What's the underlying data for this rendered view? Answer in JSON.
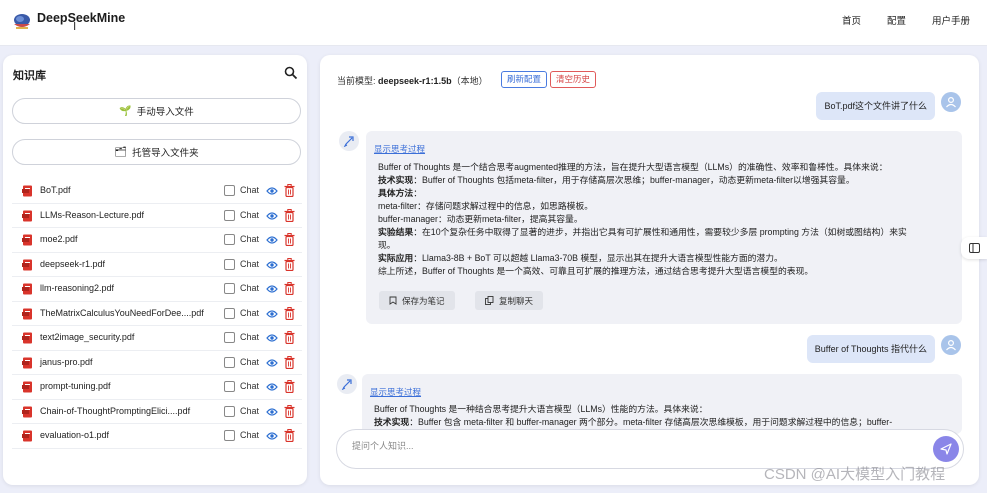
{
  "header": {
    "brand": "DeepSeekMine",
    "nav": [
      "首页",
      "配置",
      "用户手册"
    ]
  },
  "knowledge_base": {
    "title": "知识库",
    "manual_import_label": "手动导入文件",
    "managed_import_label": "托管导入文件夹",
    "chat_label": "Chat",
    "files": [
      "BoT.pdf",
      "LLMs-Reason-Lecture.pdf",
      "moe2.pdf",
      "deepseek-r1.pdf",
      "llm-reasoning2.pdf",
      "TheMatrixCalculusYouNeedForDee....pdf",
      "text2image_security.pdf",
      "janus-pro.pdf",
      "prompt-tuning.pdf",
      "Chain-of-ThoughtPromptingElici....pdf",
      "evaluation-o1.pdf"
    ]
  },
  "chat": {
    "model_prefix": "当前模型:",
    "model_name": "deepseek-r1:1.5b",
    "model_suffix": "（本地）",
    "refresh_label": "刷新配置",
    "clear_label": "清空历史",
    "messages": [
      {
        "user": "BoT.pdf这个文件讲了什么",
        "think_link": "显示思考过程",
        "answer_lines": [
          {
            "bold": "",
            "text": "Buffer of Thoughts 是一个结合思考augmented推理的方法，旨在提升大型语言模型（LLMs）的准确性、效率和鲁棒性。具体来说："
          },
          {
            "bold": "技术实现",
            "text": "：Buffer of Thoughts 包括meta-filter，用于存储高层次思维；buffer-manager，动态更新meta-filter以增强其容量。"
          },
          {
            "bold": "具体方法",
            "text": "："
          },
          {
            "bold": "",
            "text": "meta-filter：存储问题求解过程中的信息，如思路模板。"
          },
          {
            "bold": "",
            "text": "buffer-manager：动态更新meta-filter，提高其容量。"
          },
          {
            "bold": "实验结果",
            "text": "：在10个复杂任务中取得了显著的进步，并指出它具有可扩展性和通用性，需要较少多层 prompting 方法（如树或图结构）来实"
          },
          {
            "bold": "",
            "text": "现。"
          },
          {
            "bold": "实际应用",
            "text": "：Llama3-8B + BoT 可以超越 Llama3-70B 模型，显示出其在提升大语言模型性能方面的潜力。"
          },
          {
            "bold": "",
            "text": "综上所述，Buffer of Thoughts 是一个高效、可靠且可扩展的推理方法，通过结合思考提升大型语言模型的表现。"
          }
        ],
        "save_note_label": "保存为笔记",
        "copy_chat_label": "复制聊天"
      },
      {
        "user": "Buffer of Thoughts 指代什么",
        "think_link": "显示思考过程",
        "answer_lines": [
          {
            "bold": "",
            "text": "Buffer of Thoughts 是一种结合思考提升大语言模型（LLMs）性能的方法。具体来说："
          },
          {
            "bold": "技术实现",
            "text": "：Buffer 包含 meta-filter 和 buffer-manager 两个部分。meta-filter 存储高层次思维模板，用于问题求解过程中的信息；buffer-"
          }
        ]
      }
    ],
    "input_placeholder": "提问个人知识..."
  },
  "watermark": "CSDN @AI大模型入门教程"
}
